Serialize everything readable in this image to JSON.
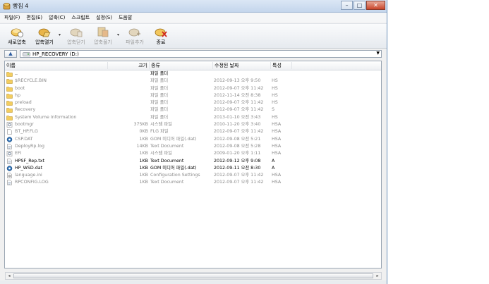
{
  "window": {
    "title": "빵집 4"
  },
  "menu": [
    {
      "label": "파일(F)"
    },
    {
      "label": "편집(E)"
    },
    {
      "label": "압축(C)"
    },
    {
      "label": "스크립트"
    },
    {
      "label": "설정(S)"
    },
    {
      "label": "도움말"
    }
  ],
  "toolbar": {
    "new_archive": "새로압축",
    "open_archive": "압축열기",
    "close_archive": "압축닫기",
    "extract": "압축풀기",
    "add_file": "파일추가",
    "exit": "종료"
  },
  "address": {
    "path": "HP_RECOVERY (D:)"
  },
  "columns": {
    "name": "이름",
    "size": "크기",
    "type": "종류",
    "modified": "수정된 날짜",
    "attr": "특성"
  },
  "files": [
    {
      "name": "..",
      "size": "",
      "type": "파일 폴더",
      "modified": "",
      "attr": "",
      "icon": "folder-icon",
      "style": "bold"
    },
    {
      "name": "$RECYCLE.BIN",
      "size": "",
      "type": "파일 폴더",
      "modified": "2012-09-13 오후 9:50",
      "attr": "HS",
      "icon": "folder-icon",
      "style": "dim"
    },
    {
      "name": "boot",
      "size": "",
      "type": "파일 폴더",
      "modified": "2012-09-07 오후 11:42",
      "attr": "HS",
      "icon": "folder-icon",
      "style": "dim"
    },
    {
      "name": "hp",
      "size": "",
      "type": "파일 폴더",
      "modified": "2012-11-14 오전 8:38",
      "attr": "HS",
      "icon": "folder-icon",
      "style": "dim"
    },
    {
      "name": "preload",
      "size": "",
      "type": "파일 폴더",
      "modified": "2012-09-07 오후 11:42",
      "attr": "HS",
      "icon": "folder-icon",
      "style": "dim"
    },
    {
      "name": "Recovery",
      "size": "",
      "type": "파일 폴더",
      "modified": "2012-09-07 오후 11:42",
      "attr": "S",
      "icon": "folder-icon",
      "style": "dim"
    },
    {
      "name": "System Volume Information",
      "size": "",
      "type": "파일 폴더",
      "modified": "2013-01-10 오전 3:43",
      "attr": "HS",
      "icon": "folder-icon",
      "style": "dim"
    },
    {
      "name": "bootmgr",
      "size": "375KB",
      "type": "시스템 파일",
      "modified": "2010-11-20 오후 3:40",
      "attr": "HSA",
      "icon": "system-file-icon",
      "style": "dim"
    },
    {
      "name": "BT_HP.FLG",
      "size": "0KB",
      "type": "FLG 파일",
      "modified": "2012-09-07 오후 11:42",
      "attr": "HSA",
      "icon": "file-icon",
      "style": "dim"
    },
    {
      "name": "CSP.DAT",
      "size": "1KB",
      "type": "GOM 미디어 파일(.dat)",
      "modified": "2012-09-08 오전 5:21",
      "attr": "HSA",
      "icon": "gom-media-icon",
      "style": "dim"
    },
    {
      "name": "DeployRp.log",
      "size": "14KB",
      "type": "Text Document",
      "modified": "2012-09-08 오전 5:28",
      "attr": "HSA",
      "icon": "text-file-icon",
      "style": "dim"
    },
    {
      "name": "EFI",
      "size": "1KB",
      "type": "시스템 파일",
      "modified": "2009-01-20 오후 1:11",
      "attr": "HSA",
      "icon": "system-file-icon",
      "style": "dim"
    },
    {
      "name": "HPSF_Rep.txt",
      "size": "1KB",
      "type": "Text Document",
      "modified": "2012-09-12 오후 9:08",
      "attr": "A",
      "icon": "text-file-icon",
      "style": "bold"
    },
    {
      "name": "HP_WSD.dat",
      "size": "1KB",
      "type": "GOM 미디어 파일(.dat)",
      "modified": "2012-09-11 오전 8:30",
      "attr": "A",
      "icon": "gom-media-icon",
      "style": "bold"
    },
    {
      "name": "language.ini",
      "size": "1KB",
      "type": "Configuration Settings",
      "modified": "2012-09-07 오후 11:42",
      "attr": "HSA",
      "icon": "settings-file-icon",
      "style": "dim"
    },
    {
      "name": "RPCONFIG.LOG",
      "size": "1KB",
      "type": "Text Document",
      "modified": "2012-09-07 오후 11:42",
      "attr": "HSA",
      "icon": "text-file-icon",
      "style": "dim"
    }
  ]
}
